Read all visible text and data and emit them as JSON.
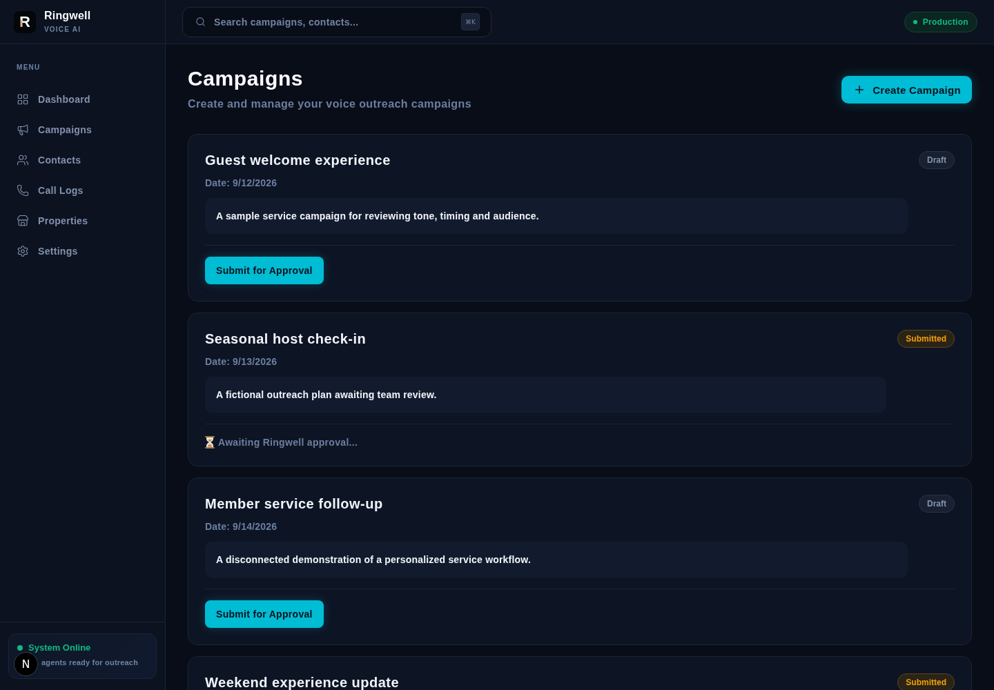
{
  "brand": {
    "mark": "R",
    "name": "Ringwell",
    "tagline": "VOICE AI"
  },
  "search": {
    "placeholder": "Search campaigns, contacts...",
    "shortcut": "⌘K"
  },
  "environment": {
    "label": "Production",
    "live": true
  },
  "sidebar": {
    "section_label": "MENU",
    "items": [
      {
        "label": "Dashboard",
        "selected": false
      },
      {
        "label": "Campaigns",
        "selected": false
      },
      {
        "label": "Contacts",
        "selected": false
      },
      {
        "label": "Call Logs",
        "selected": false
      },
      {
        "label": "Properties",
        "selected": false
      },
      {
        "label": "Settings",
        "selected": false
      }
    ]
  },
  "system_status": {
    "label": "System Online",
    "detail": "agents ready for outreach",
    "online": true
  },
  "dev_badge": {
    "label": "N"
  },
  "page": {
    "title": "Campaigns",
    "subtitle": "Create and manage your voice outreach campaigns",
    "create_button": "Create Campaign"
  },
  "campaigns": [
    {
      "title": "Guest welcome experience",
      "date": "Date: 9/12/2026",
      "description": "A sample service campaign for reviewing tone, timing and audience.",
      "status": {
        "kind": "draft",
        "label": "Draft"
      },
      "footer": {
        "kind": "action",
        "label": "Submit for Approval"
      }
    },
    {
      "title": "Seasonal host check-in",
      "date": "Date: 9/13/2026",
      "description": "A fictional outreach plan awaiting team review.",
      "status": {
        "kind": "submitted",
        "label": "Submitted"
      },
      "footer": {
        "kind": "pending",
        "label": "Awaiting Ringwell approval..."
      }
    },
    {
      "title": "Member service follow-up",
      "date": "Date: 9/14/2026",
      "description": "A disconnected demonstration of a personalized service workflow.",
      "status": {
        "kind": "draft",
        "label": "Draft"
      },
      "footer": {
        "kind": "action",
        "label": "Submit for Approval"
      }
    },
    {
      "title": "Weekend experience update",
      "status": {
        "kind": "submitted",
        "label": "Submitted"
      }
    }
  ]
}
